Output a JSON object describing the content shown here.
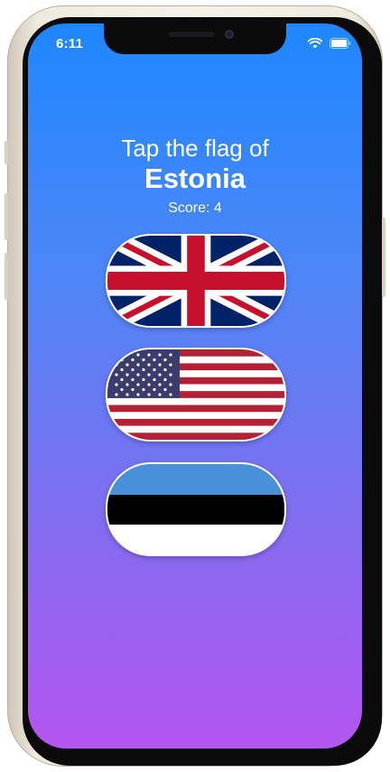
{
  "status_bar": {
    "time": "6:11",
    "icons": [
      "wifi-icon",
      "battery-icon"
    ]
  },
  "game": {
    "prompt": "Tap the flag of",
    "country": "Estonia",
    "score": "Score: 4"
  },
  "flags": [
    {
      "name": "United Kingdom",
      "icon": "uk-flag-icon"
    },
    {
      "name": "United States",
      "icon": "us-flag-icon"
    },
    {
      "name": "Estonia",
      "icon": "estonia-flag-icon"
    }
  ],
  "colors": {
    "gradient_top": "#1e87ff",
    "gradient_bottom": "#b455ef",
    "text": "#ffffff"
  }
}
